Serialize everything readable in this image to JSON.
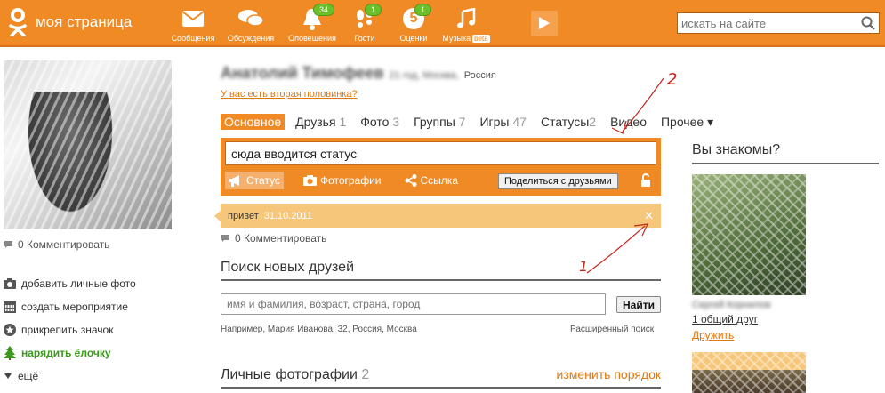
{
  "header": {
    "logo_text": "моя страница",
    "nav": [
      {
        "label": "Сообщения",
        "icon": "envelope-icon",
        "badge": ""
      },
      {
        "label": "Обсуждения",
        "icon": "speech-bubbles-icon",
        "badge": ""
      },
      {
        "label": "Оповещения",
        "icon": "bell-icon",
        "badge": "34"
      },
      {
        "label": "Гости",
        "icon": "footprints-icon",
        "badge": "1"
      },
      {
        "label": "Оценки",
        "icon": "rating-five-icon",
        "badge": "1",
        "glyph": "5"
      },
      {
        "label": "Музыка",
        "icon": "music-note-icon",
        "badge": "",
        "beta": "beta"
      }
    ],
    "search_placeholder": "искать на сайте"
  },
  "left": {
    "comments": "0 Комментировать",
    "links": [
      {
        "label": "добавить личные фото",
        "icon": "camera-icon"
      },
      {
        "label": "создать мероприятие",
        "icon": "calendar-icon"
      },
      {
        "label": "прикрепить значок",
        "icon": "badge-star-icon"
      },
      {
        "label": "нарядить ёлочку",
        "icon": "christmas-tree-icon"
      },
      {
        "label": "ещё",
        "icon": "triangle-down-icon"
      }
    ]
  },
  "profile": {
    "name_blurred": "Анатолий Тимофеев",
    "location_blurred": "21 год, Москва,",
    "country": "Россия",
    "second_half_link": "У вас есть вторая половинка?"
  },
  "tabs": [
    {
      "label": "Основное",
      "count": "",
      "active": true
    },
    {
      "label": "Друзья",
      "count": "1"
    },
    {
      "label": "Фото",
      "count": "3"
    },
    {
      "label": "Группы",
      "count": "7"
    },
    {
      "label": "Игры",
      "count": "47"
    },
    {
      "label": "Статусы",
      "count": "2"
    },
    {
      "label": "Видео",
      "count": ""
    },
    {
      "label": "Прочее ▾",
      "count": ""
    }
  ],
  "status_box": {
    "input_value": "сюда вводится статус",
    "actions": [
      {
        "label": "Статус",
        "icon": "megaphone-icon"
      },
      {
        "label": "Фотографии",
        "icon": "camera-icon"
      },
      {
        "label": "Ссылка",
        "icon": "share-link-icon"
      }
    ],
    "share_button": "Поделиться с друзьями"
  },
  "status_post": {
    "text": "привет",
    "date": "31.10.2011"
  },
  "status_comments": "0 Комментировать",
  "find_friends": {
    "title": "Поиск новых друзей",
    "placeholder": "имя и фамилия, возраст, страна, город",
    "button": "Найти",
    "example": "Например, Мария Иванова, 32, Россия, Москва",
    "advanced": "Расширенный поиск"
  },
  "photos": {
    "title": "Личные фотографии",
    "count": "2",
    "reorder": "изменить порядок"
  },
  "suggest": {
    "title": "Вы знакомы?",
    "friend_name_blurred": "Сергей Корнилов",
    "mutual": "1 общий друг",
    "befriend": "Дружить"
  },
  "annotations": [
    "1",
    "2"
  ]
}
